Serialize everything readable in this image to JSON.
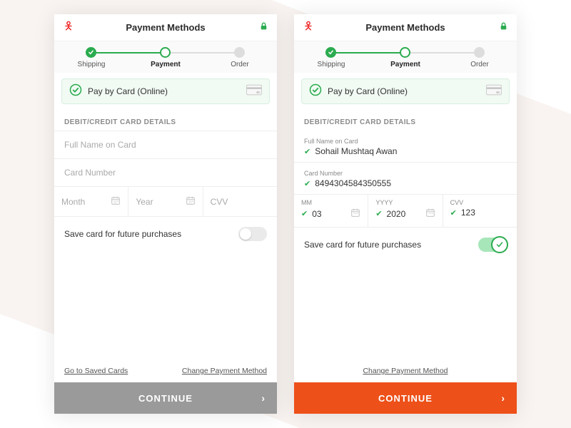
{
  "title": "Payment Methods",
  "stepper": {
    "s1": "Shipping",
    "s2": "Payment",
    "s3": "Order"
  },
  "pill": "Pay by Card (Online)",
  "section": "DEBIT/CREDIT CARD DETAILS",
  "empty": {
    "name": "Full Name on Card",
    "num": "Card Number",
    "month": "Month",
    "year": "Year",
    "cvv": "CVV"
  },
  "filled": {
    "nameLabel": "Full Name on Card",
    "nameVal": "Sohail Mushtaq Awan",
    "numLabel": "Card Number",
    "numVal": "8494304584350555",
    "mmLabel": "MM",
    "mmVal": "03",
    "yyLabel": "YYYY",
    "yyVal": "2020",
    "cvvLabel": "CVV",
    "cvvVal": "123"
  },
  "saveLabel": "Save card for future purchases",
  "link1": "Go to Saved Cards",
  "link2": "Change Payment Method",
  "cta": "CONTINUE"
}
